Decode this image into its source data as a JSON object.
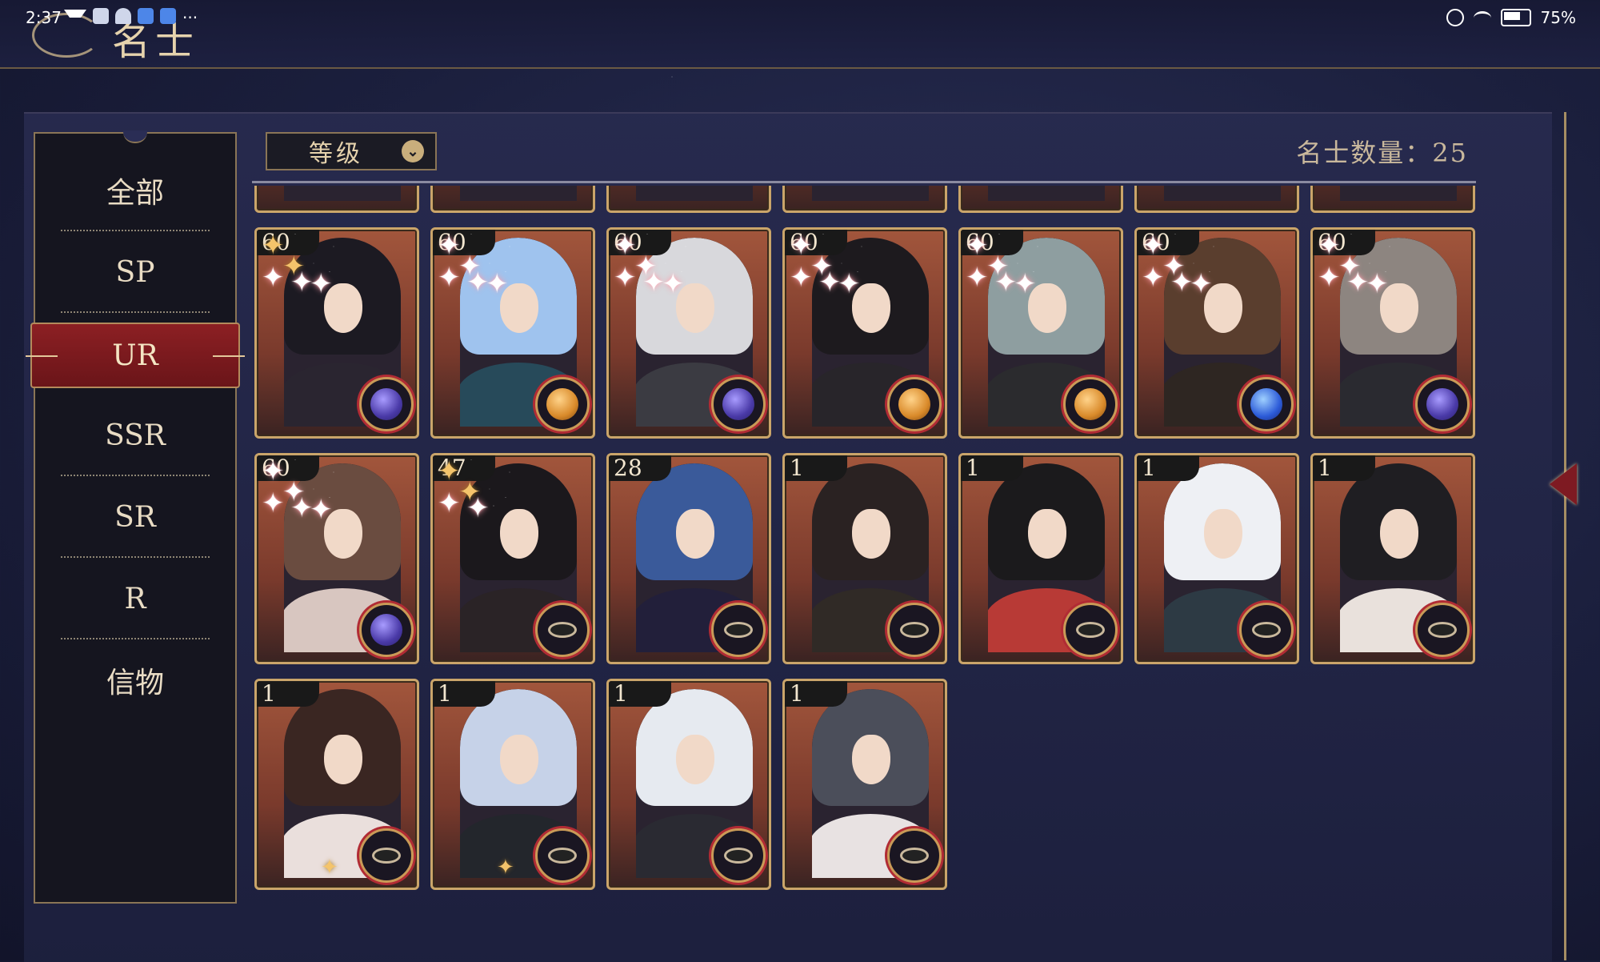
{
  "statusbar": {
    "time": "2:37",
    "more": "···",
    "battery": "75%"
  },
  "title": "名士",
  "sidebar": {
    "tabs": [
      "全部",
      "SP",
      "UR",
      "SSR",
      "SR",
      "R",
      "信物"
    ],
    "active": "UR"
  },
  "filter": {
    "label": "等级"
  },
  "count": {
    "label": "名士数量：25"
  },
  "cards": [
    {
      "level": "60",
      "stars": 5,
      "gold": true,
      "badge": "purple",
      "hair": "#1c1a22",
      "robe": "#2a2530"
    },
    {
      "level": "60",
      "stars": 5,
      "gold": false,
      "badge": "orange",
      "hair": "#9fc3ee",
      "robe": "#274a5a"
    },
    {
      "level": "60",
      "stars": 5,
      "gold": false,
      "badge": "purple",
      "hair": "#d8d8dc",
      "robe": "#3b3b42"
    },
    {
      "level": "60",
      "stars": 5,
      "gold": false,
      "badge": "orange",
      "hair": "#1d1a1e",
      "robe": "#28252a"
    },
    {
      "level": "60",
      "stars": 5,
      "gold": false,
      "badge": "orange",
      "hair": "#8e9ea0",
      "robe": "#2b2b2e"
    },
    {
      "level": "60",
      "stars": 5,
      "gold": false,
      "badge": "blue",
      "hair": "#5a3e2e",
      "robe": "#2e2622"
    },
    {
      "level": "60",
      "stars": 5,
      "gold": false,
      "badge": "purple",
      "hair": "#8d8580",
      "robe": "#2a2a30"
    },
    {
      "level": "60",
      "stars": 5,
      "gold": false,
      "badge": "purple",
      "hair": "#6a4c40",
      "robe": "#d8c6c0"
    },
    {
      "level": "47",
      "stars": 4,
      "gold": true,
      "badge": "plain",
      "hair": "#1b181c",
      "robe": "#2a2326"
    },
    {
      "level": "28",
      "stars": 0,
      "gold": false,
      "badge": "plain",
      "hair": "#3a5a9a",
      "robe": "#221f3a"
    },
    {
      "level": "1",
      "stars": 0,
      "gold": false,
      "badge": "plain",
      "hair": "#2a2222",
      "robe": "#302a26"
    },
    {
      "level": "1",
      "stars": 0,
      "gold": false,
      "badge": "plain",
      "hair": "#1b1a1c",
      "robe": "#b83a36"
    },
    {
      "level": "1",
      "stars": 0,
      "gold": false,
      "badge": "plain",
      "hair": "#eef0f4",
      "robe": "#2d3a44"
    },
    {
      "level": "1",
      "stars": 0,
      "gold": false,
      "badge": "plain",
      "hair": "#1f1e22",
      "robe": "#e9e1dc"
    },
    {
      "level": "1",
      "stars": 0,
      "gold": true,
      "badge": "plain",
      "hair": "#3a2622",
      "robe": "#eadfdc"
    },
    {
      "level": "1",
      "stars": 0,
      "gold": true,
      "badge": "plain",
      "hair": "#c6d2e8",
      "robe": "#23262c"
    },
    {
      "level": "1",
      "stars": 0,
      "gold": false,
      "badge": "plain",
      "hair": "#e6eaf0",
      "robe": "#2a2a32"
    },
    {
      "level": "1",
      "stars": 0,
      "gold": false,
      "badge": "plain",
      "hair": "#4b4e5a",
      "robe": "#e8e2e2"
    }
  ],
  "partial_row": [
    {
      "hair": "#2a1f1c"
    },
    {
      "hair": "#8a6c5c"
    },
    {
      "hair": "#6c5a4c"
    },
    {
      "hair": "#3a2622"
    },
    {
      "hair": "#7a6a5a"
    },
    {
      "hair": "#4a3a34"
    },
    {
      "hair": "#5a4a46"
    }
  ]
}
